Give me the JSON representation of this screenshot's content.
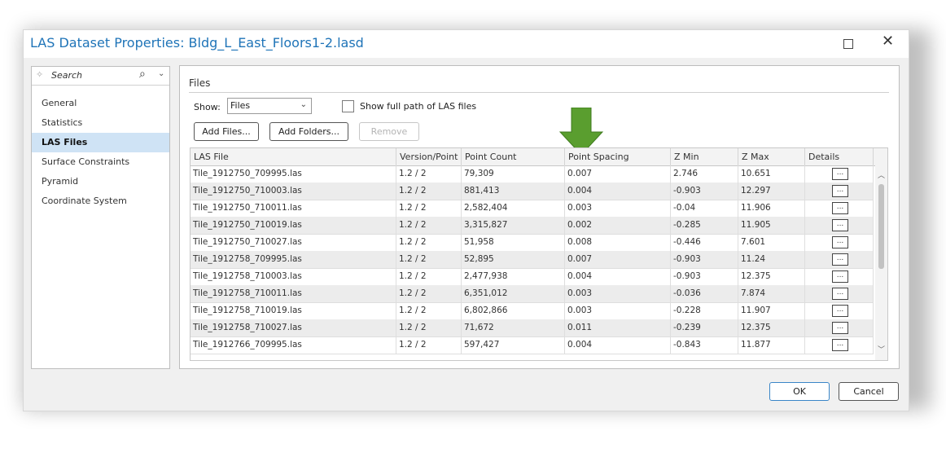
{
  "window": {
    "title": "LAS Dataset Properties: Bldg_L_East_Floors1-2.lasd",
    "maximize_icon": "maximize-icon",
    "close_icon": "close-icon",
    "accent": "#1f74b8"
  },
  "search": {
    "placeholder": "Search",
    "icon": "search-icon"
  },
  "nav": {
    "items": [
      {
        "label": "General"
      },
      {
        "label": "Statistics"
      },
      {
        "label": "LAS Files",
        "active": true
      },
      {
        "label": "Surface Constraints"
      },
      {
        "label": "Pyramid"
      },
      {
        "label": "Coordinate System"
      }
    ]
  },
  "files": {
    "section_title": "Files",
    "show_label": "Show:",
    "show_value": "Files",
    "full_path_label": "Show full path of LAS files",
    "full_path_checked": false,
    "add_files": "Add Files...",
    "add_folders": "Add Folders...",
    "remove": "Remove",
    "arrow_color": "#5a9e2f"
  },
  "table": {
    "columns": [
      "LAS File",
      "Version/Point",
      "Point Count",
      "Point Spacing",
      "Z Min",
      "Z Max",
      "Details"
    ],
    "details_label": "...",
    "rows": [
      [
        "Tile_1912750_709995.las",
        "1.2 / 2",
        "79,309",
        "0.007",
        "2.746",
        "10.651"
      ],
      [
        "Tile_1912750_710003.las",
        "1.2 / 2",
        "881,413",
        "0.004",
        "-0.903",
        "12.297"
      ],
      [
        "Tile_1912750_710011.las",
        "1.2 / 2",
        "2,582,404",
        "0.003",
        "-0.04",
        "11.906"
      ],
      [
        "Tile_1912750_710019.las",
        "1.2 / 2",
        "3,315,827",
        "0.002",
        "-0.285",
        "11.905"
      ],
      [
        "Tile_1912750_710027.las",
        "1.2 / 2",
        "51,958",
        "0.008",
        "-0.446",
        "7.601"
      ],
      [
        "Tile_1912758_709995.las",
        "1.2 / 2",
        "52,895",
        "0.007",
        "-0.903",
        "11.24"
      ],
      [
        "Tile_1912758_710003.las",
        "1.2 / 2",
        "2,477,938",
        "0.004",
        "-0.903",
        "12.375"
      ],
      [
        "Tile_1912758_710011.las",
        "1.2 / 2",
        "6,351,012",
        "0.003",
        "-0.036",
        "7.874"
      ],
      [
        "Tile_1912758_710019.las",
        "1.2 / 2",
        "6,802,866",
        "0.003",
        "-0.228",
        "11.907"
      ],
      [
        "Tile_1912758_710027.las",
        "1.2 / 2",
        "71,672",
        "0.011",
        "-0.239",
        "12.375"
      ],
      [
        "Tile_1912766_709995.las",
        "1.2 / 2",
        "597,427",
        "0.004",
        "-0.843",
        "11.877"
      ]
    ]
  },
  "footer": {
    "ok": "OK",
    "cancel": "Cancel"
  }
}
